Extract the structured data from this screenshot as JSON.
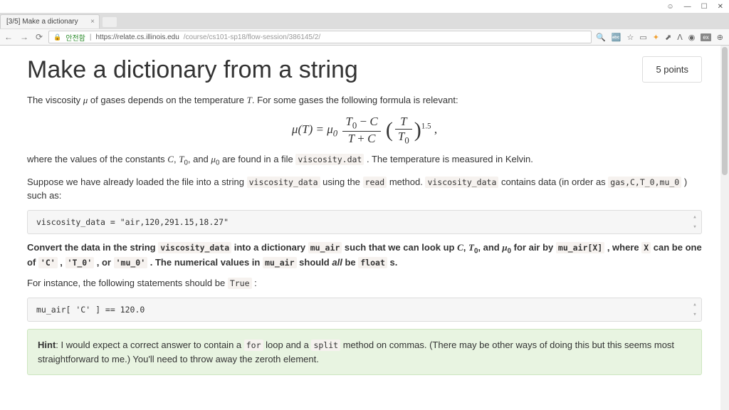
{
  "titlebar": {
    "user_icon": "☺",
    "min": "—",
    "max": "☐",
    "close": "✕"
  },
  "tab": {
    "title": "[3/5] Make a dictionary"
  },
  "nav": {
    "back": "←",
    "fwd": "→",
    "reload": "⟳"
  },
  "address": {
    "secure": "안전함",
    "host": "https://relate.cs.illinois.edu",
    "path": "/course/cs101-sp18/flow-session/386145/2/"
  },
  "page": {
    "title": "Make a dictionary from a string",
    "points": "5 points",
    "p1_a": "The viscosity ",
    "p1_b": " of gases depends on the temperature ",
    "p1_c": ". For some gases the following formula is relevant:",
    "mu": "μ",
    "T": "T",
    "T0": "T",
    "zero": "0",
    "C": "C",
    "mu0": "μ",
    "formula": {
      "eq": "μ(T) = μ",
      "minus": " − ",
      "plus": " + ",
      "exp": "1.5",
      "comma": ","
    },
    "p2_a": "where the values of the constants ",
    "p2_b": ", ",
    "p2_c": ", and ",
    "p2_d": " are found in a file ",
    "file": "viscosity.dat",
    "p2_e": " . The temperature is measured in Kelvin.",
    "p3_a": "Suppose we have already loaded the file into a string ",
    "vd": "viscosity_data",
    "p3_b": " using the ",
    "read": "read",
    "p3_c": " method. ",
    "p3_d": " contains data (in order as ",
    "order": "gas,C,T_0,mu_0",
    "p3_e": " ) such as:",
    "code1": "viscosity_data = \"air,120,291.15,18.27\"",
    "p4_a": "Convert the data in the string ",
    "p4_b": " into a dictionary ",
    "mua": "mu_air",
    "p4_c": " such that we can look up ",
    "p4_d": " for air by ",
    "muax": "mu_air[X]",
    "p4_e": " , where ",
    "x": "X",
    "p4_f": " can be one of ",
    "c": "'C'",
    "t0": "'T_0'",
    "or": " , or ",
    "m0": "'mu_0'",
    "p4_g": " . The numerical values in ",
    "p4_h": " should ",
    "all": "all",
    "p4_i": " be ",
    "flt": "float",
    "p4_j": " s.",
    "p5_a": "For instance, the following statements should be ",
    "true": "True",
    "p5_b": " :",
    "code2": "mu_air[ 'C' ]  == 120.0",
    "hint_a": "Hint",
    "hint_b": ": I would expect a correct answer to contain a ",
    "for": "for",
    "hint_c": " loop and a ",
    "split": "split",
    "hint_d": " method on commas. (There may be other ways of doing this but this seems most straightforward to me.) You'll need to throw away the zeroth element."
  }
}
